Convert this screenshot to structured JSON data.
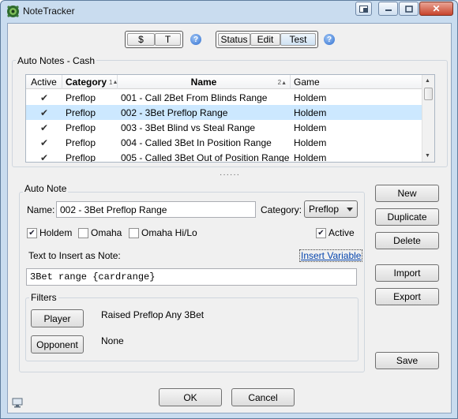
{
  "window": {
    "title": "NoteTracker"
  },
  "toolbar": {
    "mode_dollar": "$",
    "mode_t": "T",
    "status_label": "Status",
    "edit_label": "Edit",
    "test_label": "Test",
    "help_glyph": "?"
  },
  "auto_notes_group": {
    "title": "Auto Notes - Cash",
    "columns": {
      "active": "Active",
      "category": "Category",
      "category_sort": "1",
      "name": "Name",
      "name_sort": "2",
      "game": "Game"
    },
    "rows": [
      {
        "active": true,
        "category": "Preflop",
        "name": "001 - Call 2Bet From Blinds Range",
        "game": "Holdem"
      },
      {
        "active": true,
        "category": "Preflop",
        "name": "002 - 3Bet Preflop Range",
        "game": "Holdem"
      },
      {
        "active": true,
        "category": "Preflop",
        "name": "003 - 3Bet Blind vs Steal Range",
        "game": "Holdem"
      },
      {
        "active": true,
        "category": "Preflop",
        "name": "004 - Called 3Bet In Position Range",
        "game": "Holdem"
      },
      {
        "active": true,
        "category": "Preflop",
        "name": "005 - Called 3Bet Out of Position Range",
        "game": "Holdem"
      }
    ],
    "selected_row": 1
  },
  "auto_note": {
    "title": "Auto Note",
    "name_label": "Name:",
    "name_value": "002 - 3Bet Preflop Range",
    "category_label": "Category:",
    "category_value": "Preflop",
    "holdem_label": "Holdem",
    "holdem_checked": true,
    "omaha_label": "Omaha",
    "omaha_checked": false,
    "omaha_hilo_label": "Omaha Hi/Lo",
    "omaha_hilo_checked": false,
    "active_label": "Active",
    "active_checked": true,
    "text_label": "Text to Insert as Note:",
    "insert_variable_link": "Insert Variable",
    "note_text": "3Bet range {cardrange}",
    "filters": {
      "title": "Filters",
      "player_button": "Player",
      "player_value": "Raised Preflop Any 3Bet",
      "opponent_button": "Opponent",
      "opponent_value": "None"
    }
  },
  "side_buttons": {
    "new": "New",
    "duplicate": "Duplicate",
    "delete": "Delete",
    "import": "Import",
    "export": "Export",
    "save": "Save"
  },
  "footer": {
    "ok": "OK",
    "cancel": "Cancel"
  },
  "colors": {
    "selection": "#cce8ff",
    "link": "#0645ad",
    "frame": "#c9dcef"
  }
}
